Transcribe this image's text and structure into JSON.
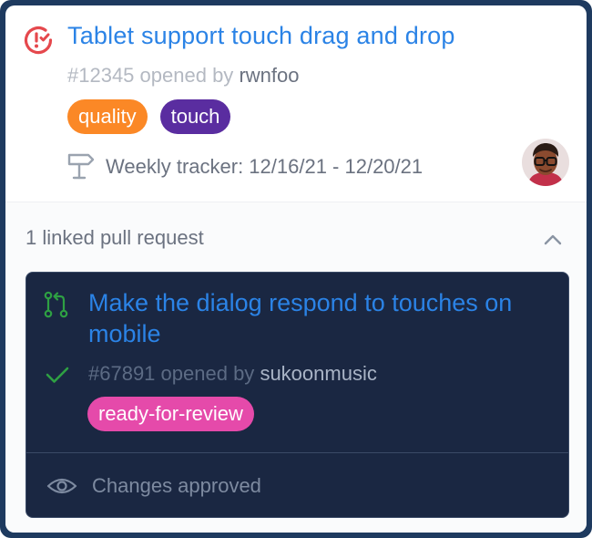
{
  "issue": {
    "title": "Tablet support touch drag and drop",
    "number": "#12345",
    "opened_by_text": "opened by",
    "author": "rwnfoo",
    "labels": [
      {
        "name": "quality",
        "color": "#fb8826"
      },
      {
        "name": "touch",
        "color": "#5a2da0"
      }
    ],
    "milestone": "Weekly tracker: 12/16/21 - 12/20/21",
    "icons": {
      "status": "issue-in-progress-icon",
      "milestone": "signpost-icon",
      "assignee": "avatar"
    }
  },
  "linked": {
    "count_label": "1 linked pull request",
    "toggle_icon": "chevron-up-icon"
  },
  "pull_request": {
    "title": "Make the dialog respond to touches on mobile",
    "number": "#67891",
    "opened_by_text": "opened by",
    "author": "sukoonmusic",
    "label": "ready-for-review",
    "label_color": "#e54aaa",
    "status": "Changes approved",
    "icons": {
      "pr": "pull-request-icon",
      "check": "check-icon",
      "status": "eye-icon"
    }
  },
  "colors": {
    "accent": "#2b83e6",
    "frame": "#1e3a5f",
    "pr_background": "#1a2742",
    "success": "#2ea043",
    "danger": "#e5484d"
  }
}
